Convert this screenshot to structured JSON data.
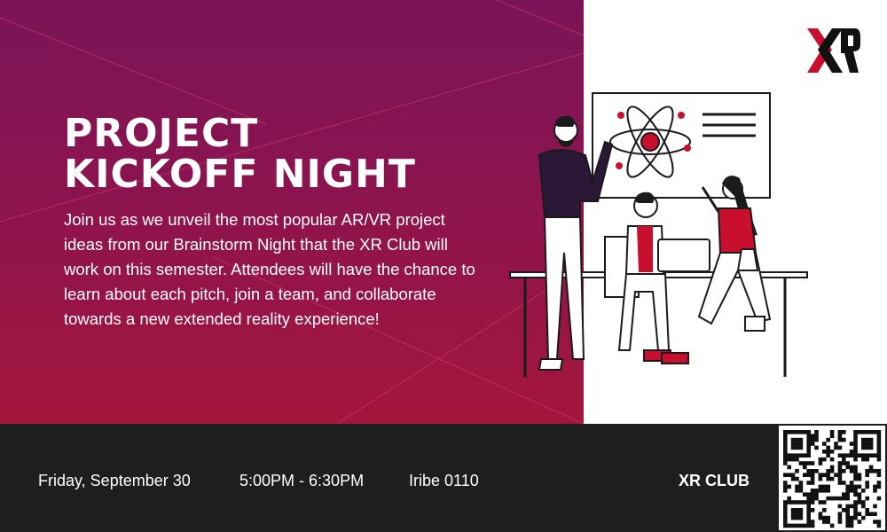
{
  "event": {
    "title_line1": "PROJECT",
    "title_line2": "KICKOFF NIGHT",
    "description": "Join us as we unveil the most popular AR/VR project ideas from our Brainstorm Night that the XR Club will work on this semester. Attendees will have the chance to learn about each pitch, join a team, and collaborate towards a new extended reality experience!"
  },
  "footer": {
    "date": "Friday, September 30",
    "time": "5:00PM - 6:30PM",
    "location": "Iribe 0110",
    "organizer": "XR CLUB"
  },
  "icons": {
    "logo": "xr-logo-icon",
    "qr": "qr-code-icon"
  },
  "colors": {
    "hero_top": "#7a1458",
    "hero_bottom": "#a3163c",
    "accent_red": "#c8102e",
    "footer_bg": "#1e1e1e"
  }
}
